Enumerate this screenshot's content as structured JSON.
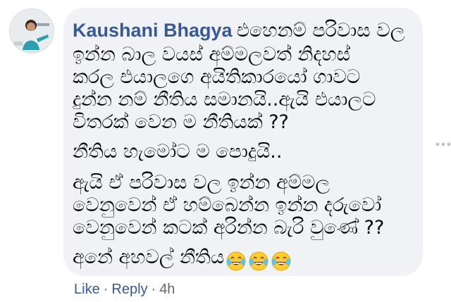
{
  "comment": {
    "author": "Kaushani Bhagya",
    "lines": [
      "එහෙනම් පරිවාස වල",
      "ඉන්න බාල වයස් අම්මලවත් නිදහස්",
      "කරල එයාලගෙ අයිතිකාරයෝ ගාවට",
      "දුන්න නම් නීතිය සමානයි..ඇයි එයාලට",
      "විතරක් වෙන ම නීතියක් ??",
      "නීතිය හැමෝට ම පොදුයි..",
      "ඇයි ඒ පරිවාස වල ඉන්න අම්මල",
      "වෙනුවෙන් ඒ හම්බෙන්න ඉන්න දරුවෝ",
      "වෙනුවෙන් කටක් අරින්න බැරි වුණේ ??",
      "අනේ අහවල් නීතිය"
    ],
    "emojis": [
      "face-with-tears-of-joy-icon",
      "face-with-tears-of-joy-icon",
      "face-with-tears-of-joy-icon"
    ]
  },
  "actions": {
    "like_label": "Like",
    "reply_label": "Reply",
    "separator": "·",
    "timestamp": "4h"
  },
  "colors": {
    "author": "#385898",
    "bubble_bg": "#f0f2f5",
    "text": "#050505",
    "meta": "#65676b"
  }
}
